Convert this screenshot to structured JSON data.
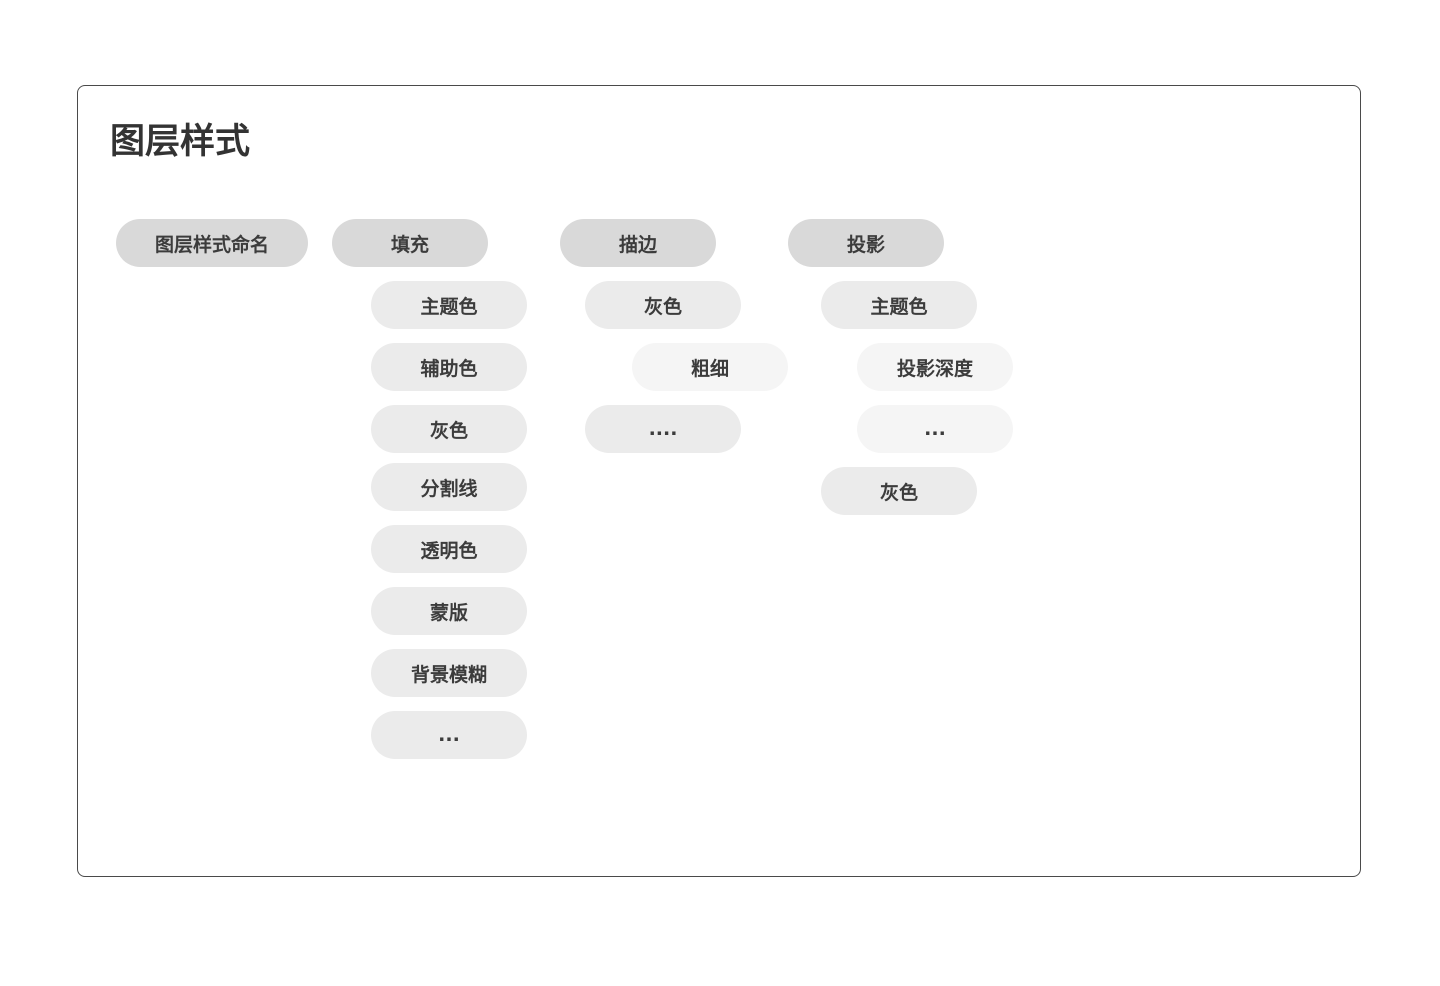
{
  "title": "图层样式",
  "columns": {
    "naming": {
      "header": "图层样式命名"
    },
    "fill": {
      "header": "填充",
      "items": [
        "主题色",
        "辅助色",
        "灰色",
        "分割线",
        "透明色",
        "蒙版",
        "背景模糊",
        "..."
      ]
    },
    "stroke": {
      "header": "描边",
      "items": [
        "灰色",
        "粗细",
        "...."
      ]
    },
    "shadow": {
      "header": "投影",
      "items": [
        "主题色",
        "投影深度",
        "...",
        "灰色"
      ]
    }
  },
  "colors": {
    "level1": "#d9d9d9",
    "level2": "#ebebeb",
    "level3": "#f5f5f5",
    "text": "#3c3c3c",
    "title": "#333333",
    "border": "#4a4a4a"
  }
}
